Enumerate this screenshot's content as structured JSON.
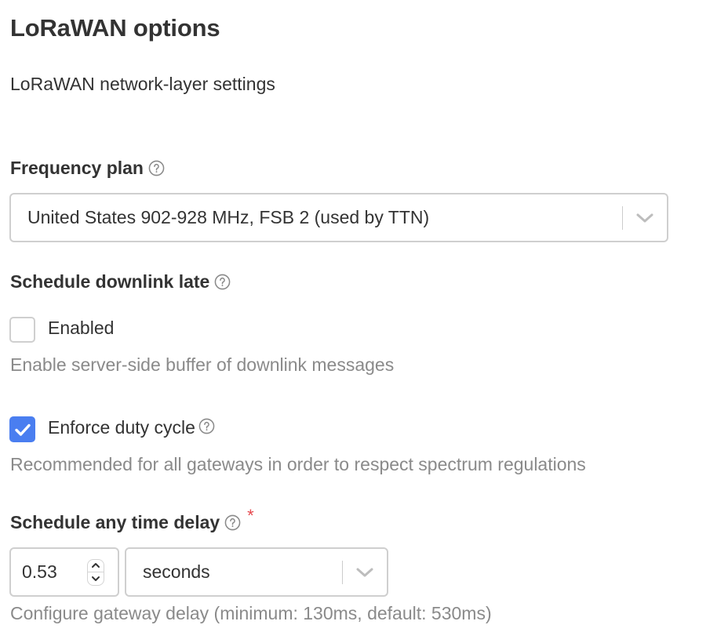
{
  "section": {
    "title": "LoRaWAN options",
    "subtitle": "LoRaWAN network-layer settings"
  },
  "frequency_plan": {
    "label": "Frequency plan",
    "help_icon": "question-circle-icon",
    "selected": "United States 902-928 MHz, FSB 2 (used by TTN)"
  },
  "schedule_downlink_late": {
    "label": "Schedule downlink late",
    "help_icon": "question-circle-icon",
    "checkbox_label": "Enabled",
    "checked": false,
    "description": "Enable server-side buffer of downlink messages"
  },
  "enforce_duty_cycle": {
    "checkbox_label": "Enforce duty cycle",
    "help_icon": "question-circle-icon",
    "checked": true,
    "description": "Recommended for all gateways in order to respect spectrum regulations"
  },
  "schedule_any_time_delay": {
    "label": "Schedule any time delay",
    "help_icon": "question-circle-icon",
    "required_mark": "*",
    "value": "0.53",
    "unit_selected": "seconds",
    "description": "Configure gateway delay (minimum: 130ms, default: 530ms)"
  },
  "colors": {
    "accent": "#4a7ef0",
    "required": "#e5484d",
    "text": "#333333",
    "muted_text": "#8a8a8a",
    "border": "#cfcfcf"
  }
}
